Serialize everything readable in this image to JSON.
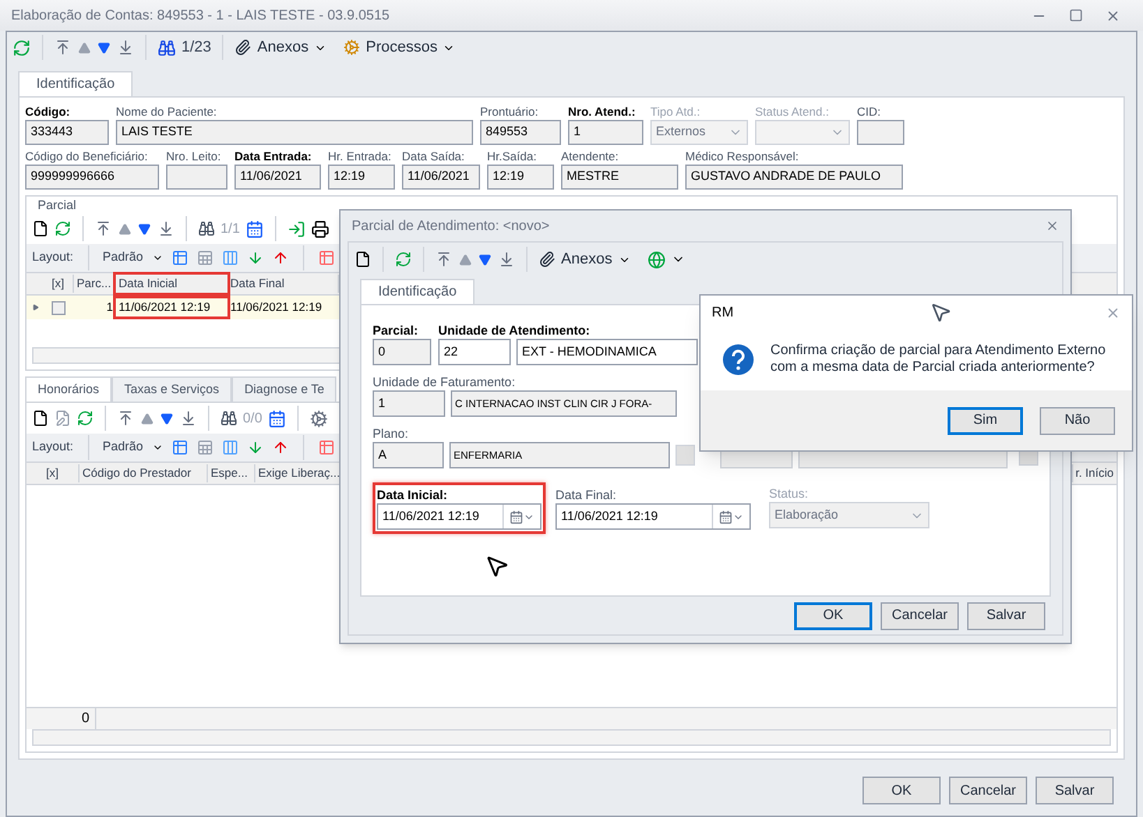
{
  "window": {
    "title": "Elaboração de Contas: 849553 - 1 - LAIS TESTE - 03.9.0515"
  },
  "toolbar": {
    "counter": "1/23",
    "menus": [
      "Anexos",
      "Processos"
    ]
  },
  "tabs": [
    {
      "label": "Identificação",
      "selected": true
    }
  ],
  "header_rows": [
    [
      {
        "label": "Código:",
        "value": "333443",
        "required": true,
        "disabled": false,
        "kind": "text"
      },
      {
        "label": "Nome do Paciente:",
        "value": "LAIS TESTE",
        "required": false,
        "disabled": false,
        "kind": "text"
      },
      {
        "label": "Prontuário:",
        "value": "849553",
        "required": false,
        "disabled": false,
        "kind": "text"
      },
      {
        "label": "Nro. Atend.:",
        "value": "1",
        "required": true,
        "disabled": false,
        "kind": "text"
      },
      {
        "label": "Tipo Atd.:",
        "value": "Externos",
        "required": false,
        "disabled": true,
        "kind": "select"
      },
      {
        "label": "Status Atend.:",
        "required": false,
        "disabled": true,
        "kind": "select"
      },
      {
        "label": "CID:",
        "required": false,
        "disabled": false,
        "kind": "text"
      }
    ],
    [
      {
        "label": "Código do Beneficiário:",
        "value": "999999996666",
        "required": false,
        "disabled": false,
        "kind": "text"
      },
      {
        "label": "Nro. Leito:",
        "required": false,
        "disabled": false,
        "kind": "text"
      },
      {
        "label": "Data Entrada:",
        "value": "11/06/2021",
        "required": true,
        "disabled": false,
        "kind": "text"
      },
      {
        "label": "Hr. Entrada:",
        "value": "12:19",
        "required": false,
        "disabled": false,
        "kind": "text"
      },
      {
        "label": "Data Saída:",
        "value": "11/06/2021",
        "required": false,
        "disabled": false,
        "kind": "text"
      },
      {
        "label": "Hr.Saída:",
        "value": "12:19",
        "required": false,
        "disabled": false,
        "kind": "text"
      },
      {
        "label": "Atendente:",
        "value": "MESTRE",
        "required": false,
        "disabled": false,
        "kind": "text"
      },
      {
        "label": "Médico Responsável:",
        "value": "GUSTAVO ANDRADE DE PAULO",
        "required": false,
        "disabled": false,
        "kind": "text"
      }
    ]
  ],
  "parcial": {
    "title": "Parcial",
    "counter": "1/1",
    "layout_label": "Layout:",
    "layout_value": "Padrão",
    "check_column": "[x]",
    "columns": [
      {
        "label": "Parc...",
        "highlighted": false
      },
      {
        "label": "Data Inicial",
        "highlighted": true
      },
      {
        "label": "Data Final",
        "highlighted": false
      }
    ],
    "rows": [
      {
        "checked": false,
        "selected": true,
        "cells": [
          "1",
          "11/06/2021 12:19",
          "11/06/2021 12:19"
        ]
      }
    ]
  },
  "detail_tabs": [
    {
      "label": "Honorários",
      "selected": true
    },
    {
      "label": "Taxas e Serviços",
      "selected": false
    },
    {
      "label": "Diagnose e Te",
      "selected": false
    }
  ],
  "detail_grid": {
    "counter": "0/0",
    "layout_label": "Layout:",
    "layout_value": "Padrão",
    "columns": [
      "[x]",
      "Código do Prestador",
      "Espe...",
      "Exige Liberaç...",
      "r. Início"
    ],
    "footer": "0"
  },
  "buttons": [
    {
      "label": "OK"
    },
    {
      "label": "Cancelar"
    },
    {
      "label": "Salvar"
    }
  ],
  "dialog": {
    "title": "Parcial de Atendimento: <novo>",
    "menu": "Anexos",
    "tab": "Identificação",
    "fields": [
      {
        "label": "Parcial:",
        "value": "0",
        "required": true
      },
      {
        "label": "Unidade de Atendimento:",
        "value": "22",
        "name": "EXT - HEMODINAMICA",
        "required": true
      },
      {
        "label": "Unidade de Faturamento:",
        "value": "1",
        "name": "C INTERNACAO INST CLIN CIR J FORA-",
        "required": false
      },
      {
        "label": "Plano:",
        "value": "A",
        "name": "ENFERMARIA",
        "required": false
      }
    ],
    "dates": [
      {
        "label": "Data Inicial:",
        "value": "11/06/2021 12:19",
        "required": true,
        "highlighted": true
      },
      {
        "label": "Data Final:",
        "value": "11/06/2021 12:19",
        "required": false,
        "highlighted": false
      }
    ],
    "status": {
      "label": "Status:",
      "value": "Elaboração",
      "disabled": true
    },
    "buttons": [
      {
        "label": "OK",
        "default": true
      },
      {
        "label": "Cancelar",
        "default": false
      },
      {
        "label": "Salvar",
        "default": false
      }
    ]
  },
  "message_box": {
    "title": "RM",
    "text": "Confirma criação de parcial para Atendimento Externo com a mesma data de Parcial criada anteriormente?",
    "buttons": [
      {
        "label": "Sim",
        "default": true
      },
      {
        "label": "Não",
        "default": false
      }
    ]
  }
}
